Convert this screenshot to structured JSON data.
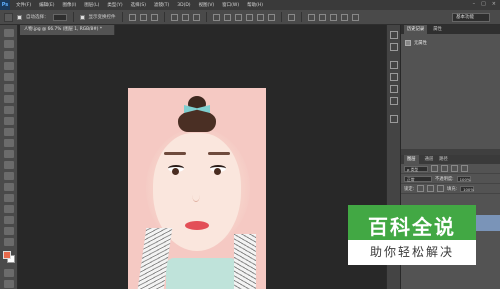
{
  "app": {
    "logo": "Ps"
  },
  "menu": [
    "文件(F)",
    "编辑(E)",
    "图像(I)",
    "图层(L)",
    "类型(Y)",
    "选择(S)",
    "滤镜(T)",
    "3D(D)",
    "视图(V)",
    "窗口(W)",
    "帮助(H)"
  ],
  "window_controls": [
    "–",
    "□",
    "×"
  ],
  "options": {
    "auto_select_label": "自动选择：",
    "auto_select_value": "组",
    "transform_label": "显示变换控件"
  },
  "workspace": "基本功能",
  "document_tab": "人物.jpg @ 66.7% (图层 1, RGB/8#) *",
  "history": {
    "tabs": [
      "历史记录",
      "属性"
    ],
    "item": "无属性"
  },
  "layers": {
    "tabs": [
      "图层",
      "通道",
      "路径"
    ],
    "kind_label": "ρ 类型",
    "mode": "正常",
    "opacity_label": "不透明度:",
    "opacity": "100%",
    "lock_label": "锁定:",
    "fill_label": "填充:",
    "fill": "100%"
  },
  "watermark": {
    "title": "百科全说",
    "subtitle": "助你轻松解决"
  },
  "colors": {
    "foreground": "#e86a4c",
    "background": "#ffffff",
    "watermark": "#42a844"
  }
}
